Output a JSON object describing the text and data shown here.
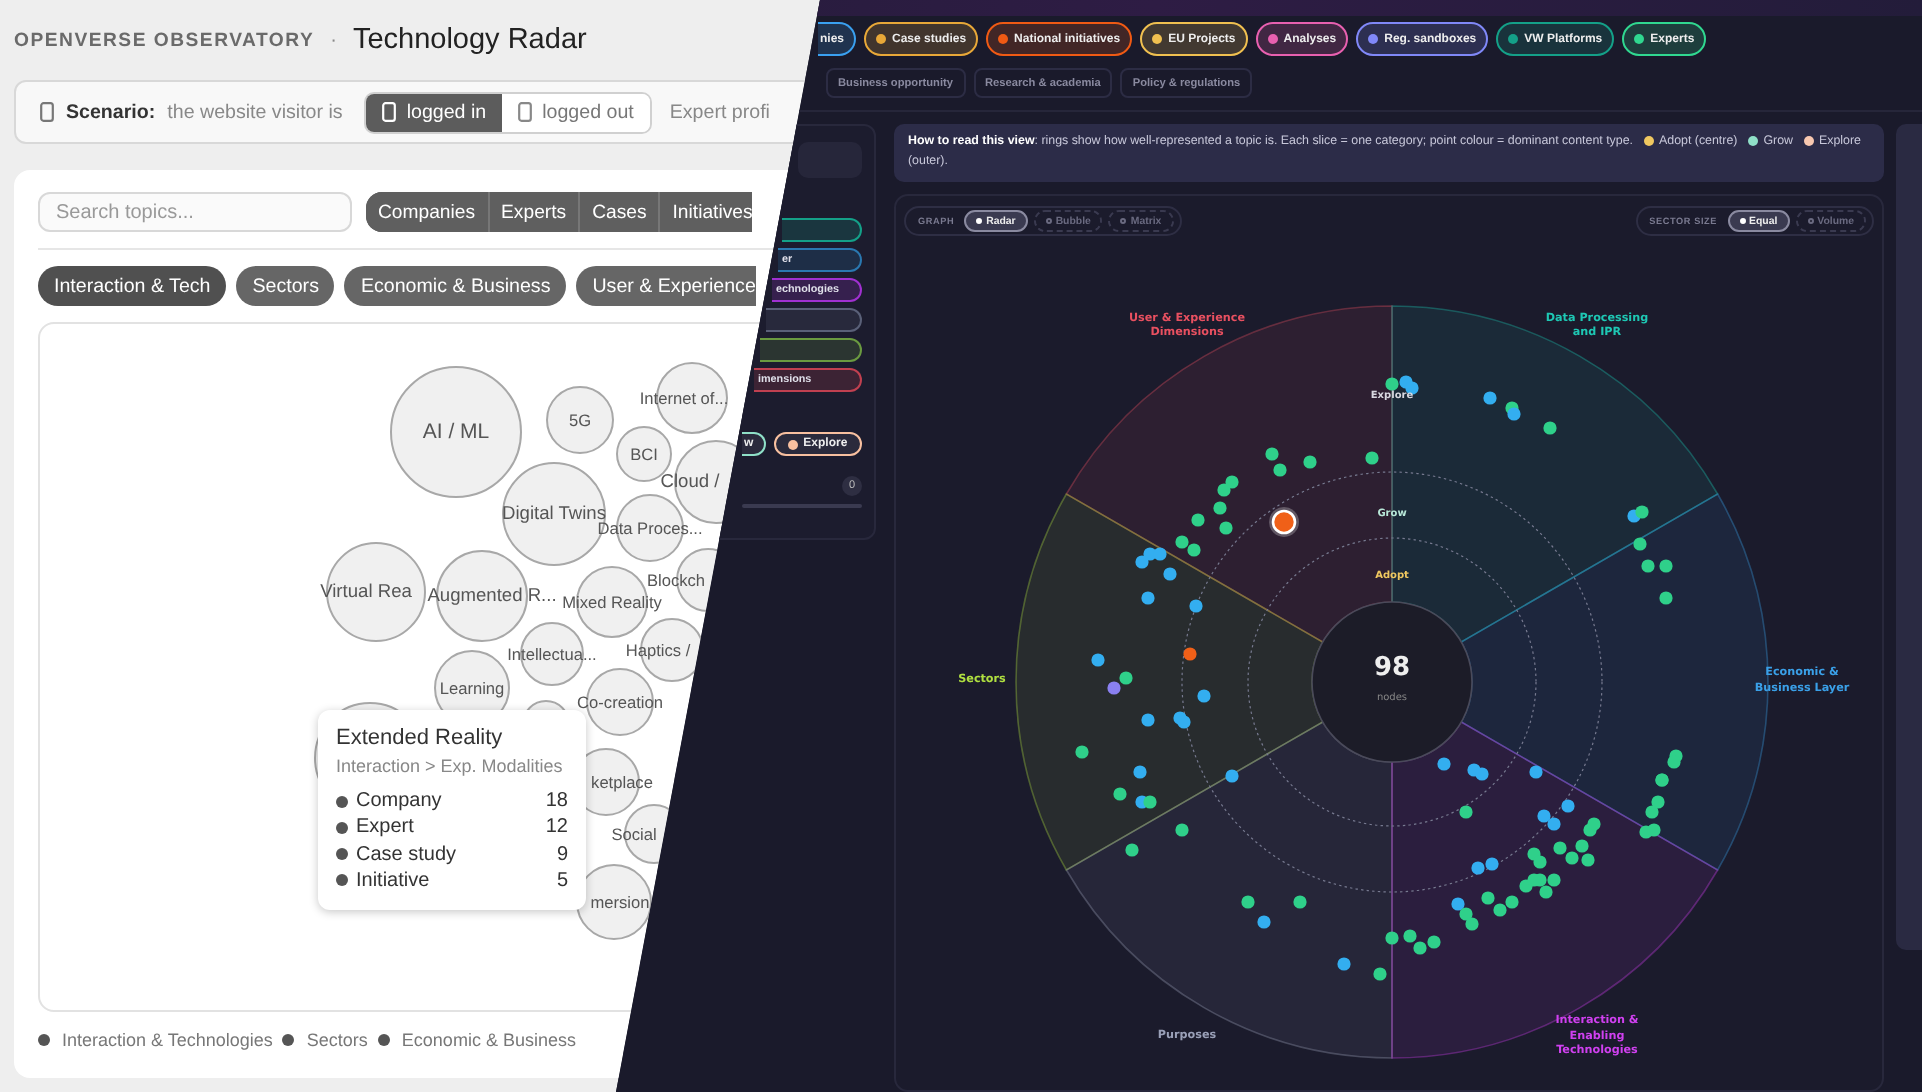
{
  "light_view": {
    "brand": "OPENVERSE OBSERVATORY",
    "separator": "·",
    "title": "Technology Radar",
    "scenario": {
      "label": "Scenario:",
      "text": "the website visitor is",
      "options": [
        {
          "label": "logged in",
          "selected": true
        },
        {
          "label": "logged out",
          "selected": false
        }
      ],
      "next_option": "Expert profi"
    },
    "search": {
      "placeholder": "Search topics..."
    },
    "content_types": [
      {
        "label": "Companies",
        "selected": true
      },
      {
        "label": "Experts",
        "selected": true
      },
      {
        "label": "Cases",
        "selected": true
      },
      {
        "label": "Initiatives",
        "selected": true
      }
    ],
    "categories": [
      {
        "label": "Interaction & Tech",
        "selected": true
      },
      {
        "label": "Sectors",
        "selected": false
      },
      {
        "label": "Economic & Business",
        "selected": false
      },
      {
        "label": "User & Experience",
        "selected": false
      }
    ],
    "bubbles": [
      {
        "label": "AI / ML"
      },
      {
        "label": "5G"
      },
      {
        "label": "Internet of..."
      },
      {
        "label": "BCI"
      },
      {
        "label": "Cloud /"
      },
      {
        "label": "Digital Twins"
      },
      {
        "label": "Data Proces..."
      },
      {
        "label": "Virtual Rea"
      },
      {
        "label": "Augmented R..."
      },
      {
        "label": "Mixed Reality"
      },
      {
        "label": "Blockch"
      },
      {
        "label": "Intellectua..."
      },
      {
        "label": "Haptics /"
      },
      {
        "label": "Learning"
      },
      {
        "label": "Co-creation"
      },
      {
        "label": "ketplace"
      },
      {
        "label": "Social"
      },
      {
        "label": "mersion"
      }
    ],
    "tooltip": {
      "title": "Extended Reality",
      "path": "Interaction > Exp. Modalities",
      "rows": [
        {
          "label": "Company",
          "value": "18"
        },
        {
          "label": "Expert",
          "value": "12"
        },
        {
          "label": "Case study",
          "value": "9"
        },
        {
          "label": "Initiative",
          "value": "5"
        }
      ]
    },
    "legend": [
      "Interaction & Technologies",
      "Sectors",
      "Economic & Business"
    ]
  },
  "dark_view": {
    "type_filters": [
      {
        "label": "nies",
        "color": "#3aa0f0",
        "dot": false
      },
      {
        "label": "Case studies",
        "color": "#e8a838",
        "dot": true
      },
      {
        "label": "National initiatives",
        "color": "#f05a14",
        "dot": true
      },
      {
        "label": "EU Projects",
        "color": "#f0c050",
        "dot": true
      },
      {
        "label": "Analyses",
        "color": "#e860b0",
        "dot": true
      },
      {
        "label": "Reg. sandboxes",
        "color": "#8088f8",
        "dot": true
      },
      {
        "label": "VW Platforms",
        "color": "#14a088",
        "dot": true
      },
      {
        "label": "Experts",
        "color": "#30d890",
        "dot": true
      }
    ],
    "perspective_tabs": [
      {
        "label": "Business opportunity",
        "selected": false
      },
      {
        "label": "Research & academia",
        "selected": false
      },
      {
        "label": "Policy & regulations",
        "selected": false
      }
    ],
    "category_filters": [
      {
        "color": "#14a088"
      },
      {
        "label": "er",
        "color": "#2a78b0"
      },
      {
        "label": "echnologies",
        "color": "#a030d0"
      },
      {
        "color": "#5a6078"
      },
      {
        "color": "#6a9a40"
      },
      {
        "label": "imensions",
        "color": "#c04050"
      }
    ],
    "ring_filters": [
      {
        "label": "w",
        "color": "#8fe0c8",
        "dot": false
      },
      {
        "label": "Explore",
        "color": "#f8c0a0",
        "dot": true
      }
    ],
    "count": "0",
    "info": {
      "text": "**How to read this view**: rings show how well-represented a topic is. Each slice = one category; point colour = dominant content type.",
      "legend": [
        {
          "label": "Adopt (centre)",
          "color": "#f0c860"
        },
        {
          "label": "Grow",
          "color": "#90e0c8"
        },
        {
          "label": "Explore",
          "color": "#f8c8b0"
        }
      ],
      "note": "(outer)."
    },
    "graph": {
      "label": "GRAPH",
      "options": [
        {
          "label": "Radar",
          "selected": true
        },
        {
          "label": "Bubble",
          "selected": false
        },
        {
          "label": "Matrix",
          "selected": false
        }
      ]
    },
    "sector_size": {
      "label": "SECTOR SIZE",
      "options": [
        {
          "label": "Equal",
          "selected": true
        },
        {
          "label": "Volume",
          "selected": false
        }
      ]
    },
    "radar": {
      "sectors": [
        {
          "label": "User & Experience Dimensions",
          "color": "#e85060"
        },
        {
          "label": "Data Processing and IPR",
          "color": "#1ec8b4"
        },
        {
          "label": "Sectors",
          "color": "#b0e040"
        },
        {
          "label": "Economic & Business Layer",
          "color": "#3aa0e8"
        },
        {
          "label": "Purposes",
          "color": "#9aa0b8"
        },
        {
          "label": "Interaction & Enabling Technologies",
          "color": "#d040f0"
        }
      ],
      "rings": [
        {
          "label": "Explore",
          "color": "#d8d8e0"
        },
        {
          "label": "Grow",
          "color": "#b8e8d8"
        },
        {
          "label": "Adopt",
          "color": "#f0c860"
        }
      ],
      "center_value": "98",
      "center_label": "nodes"
    }
  }
}
